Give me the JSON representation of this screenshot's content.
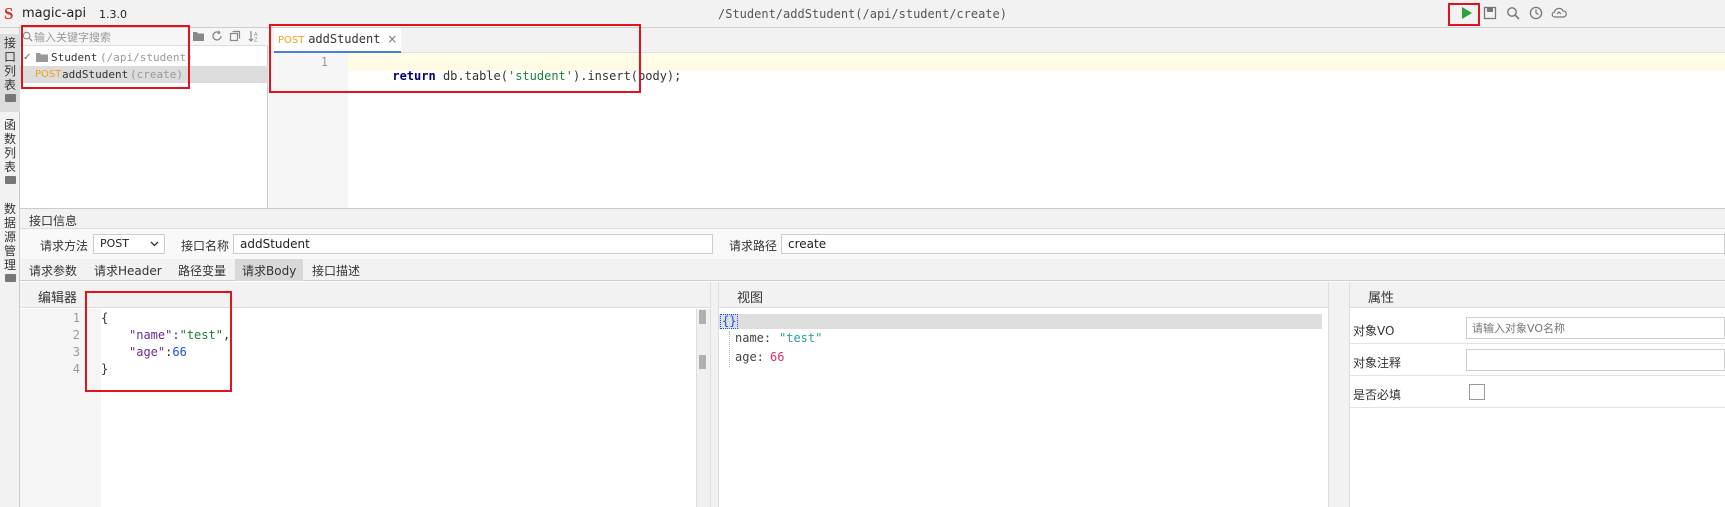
{
  "header": {
    "app_name": "magic-api",
    "version": "1.3.0",
    "path": "/Student/addStudent(/api/student/create)",
    "icons": [
      "run-icon",
      "save-icon",
      "search-icon",
      "history-icon",
      "upload-cloud-icon"
    ]
  },
  "side_tabs": [
    {
      "label": "接口列表",
      "icon": "folder-icon"
    },
    {
      "label": "函数列表",
      "icon": "folder-icon"
    },
    {
      "label": "数据源管理",
      "icon": "folder-icon"
    }
  ],
  "tree": {
    "search_placeholder": "输入关键字搜索",
    "group": {
      "name": "Student",
      "path": "(/api/student)"
    },
    "item": {
      "method": "POST",
      "name": "addStudent",
      "path": "(create)"
    }
  },
  "editor": {
    "tab": {
      "method": "POST",
      "name": "addStudent"
    },
    "lines": [
      {
        "num": "1",
        "keyword": "return",
        "pre": " db.table(",
        "string": "'student'",
        "post": ").insert(body);"
      }
    ]
  },
  "info": {
    "title": "接口信息",
    "method_label": "请求方法",
    "method_value": "POST",
    "name_label": "接口名称",
    "name_value": "addStudent",
    "path_label": "请求路径",
    "path_value": "create"
  },
  "sub_tabs": [
    "请求参数",
    "请求Header",
    "路径变量",
    "请求Body",
    "接口描述"
  ],
  "body_editor": {
    "title": "编辑器",
    "line_numbers": [
      "1",
      "2",
      "3",
      "4"
    ],
    "open_brace": "{",
    "close_brace": "}",
    "name_key": "\"name\"",
    "name_val": "\"test\"",
    "age_key": "\"age\"",
    "age_val": "66"
  },
  "view": {
    "title": "视图",
    "root": "{}",
    "name_key": "name:",
    "name_val": "\"test\"",
    "age_key": "age:",
    "age_val": "66"
  },
  "properties": {
    "title": "属性",
    "vo_label": "对象VO",
    "vo_placeholder": "请输入对象VO名称",
    "comment_label": "对象注释",
    "required_label": "是否必填"
  },
  "colors": {
    "highlight": "#e0141e",
    "run": "#2e9e3e",
    "post": "#f0a020"
  }
}
